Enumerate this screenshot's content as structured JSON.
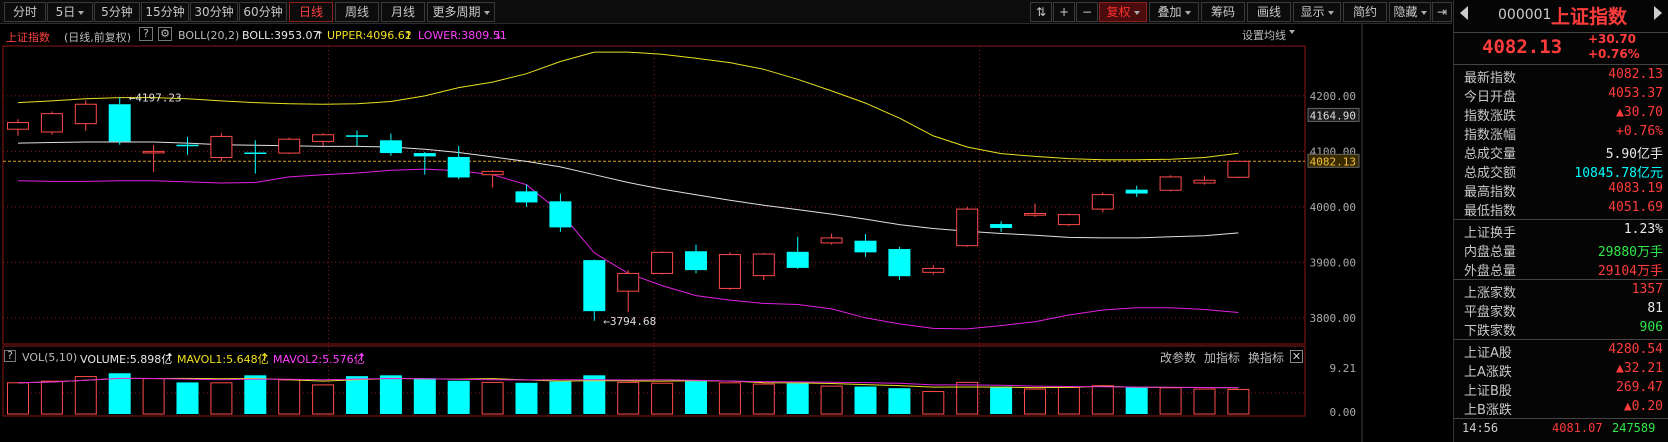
{
  "toolbar": {
    "left": [
      {
        "label": "分时",
        "x": 4,
        "w": 42
      },
      {
        "label": "5日",
        "x": 47,
        "w": 46,
        "caret": true
      },
      {
        "label": "5分钟",
        "x": 94,
        "w": 46
      },
      {
        "label": "15分钟",
        "x": 141,
        "w": 48
      },
      {
        "label": "30分钟",
        "x": 190,
        "w": 48
      },
      {
        "label": "60分钟",
        "x": 239,
        "w": 48
      },
      {
        "label": "日线",
        "x": 289,
        "w": 44,
        "active": true
      },
      {
        "label": "周线",
        "x": 335,
        "w": 44
      },
      {
        "label": "月线",
        "x": 381,
        "w": 44
      },
      {
        "label": "更多周期",
        "x": 427,
        "w": 68,
        "caret": true
      }
    ],
    "right": [
      {
        "label": "⇅",
        "x": 1030,
        "w": 22,
        "icon": "move-icon"
      },
      {
        "label": "+",
        "x": 1053,
        "w": 22,
        "icon": "zoom-in-icon"
      },
      {
        "label": "−",
        "x": 1076,
        "w": 22,
        "icon": "zoom-out-icon"
      },
      {
        "label": "复权",
        "x": 1099,
        "w": 48,
        "caret": true,
        "red": true
      },
      {
        "label": "叠加",
        "x": 1149,
        "w": 50,
        "caret": true
      },
      {
        "label": "筹码",
        "x": 1201,
        "w": 44
      },
      {
        "label": "画线",
        "x": 1247,
        "w": 44
      },
      {
        "label": "显示",
        "x": 1293,
        "w": 48,
        "caret": true
      },
      {
        "label": "简约",
        "x": 1343,
        "w": 44
      },
      {
        "label": "隐藏",
        "x": 1389,
        "w": 42,
        "caret": true
      },
      {
        "label": "⇥",
        "x": 1432,
        "w": 20,
        "icon": "collapse-icon"
      }
    ]
  },
  "info": {
    "name": "上证指数",
    "mode": "(日线,前复权)",
    "help": "?",
    "settings_icon": "gear-icon",
    "boll_label": "BOLL(20,2)",
    "boll_value": "BOLL:3953.07",
    "upper_value": "UPPER:4096.62",
    "lower_value": "LOWER:3809.51",
    "set_ma": "设置均线"
  },
  "vol_info": {
    "label": "VOL(5,10)",
    "volume": "VOLUME:5.898亿",
    "mavol1": "MAVOL1:5.648亿",
    "mavol2": "MAVOL2:5.576亿",
    "btn1": "改参数",
    "btn2": "加指标",
    "btn3": "换指标"
  },
  "chart_data": {
    "type": "candlestick",
    "ylim": [
      3760,
      4290
    ],
    "yticks": [
      3800,
      3900,
      4000,
      4100,
      4200
    ],
    "vol_ylim": [
      0,
      10.1
    ],
    "vol_ticks": [
      "9.21",
      "0.00"
    ],
    "price_labels": {
      "current": "4082.13",
      "upper": "4164.90"
    },
    "annotations": [
      {
        "text": "4197.23",
        "index": 3,
        "value": 4197.23
      },
      {
        "text": "3794.68",
        "index": 17,
        "value": 3794.68
      }
    ],
    "candles": [
      {
        "o": 4140,
        "c": 4152,
        "h": 4158,
        "l": 4128,
        "v": 7.5
      },
      {
        "o": 4135,
        "c": 4168,
        "h": 4172,
        "l": 4130,
        "v": 7.9
      },
      {
        "o": 4150,
        "c": 4185,
        "h": 4192,
        "l": 4137,
        "v": 9.0
      },
      {
        "o": 4185,
        "c": 4118,
        "h": 4197.23,
        "l": 4112,
        "v": 9.8
      },
      {
        "o": 4098,
        "c": 4100,
        "h": 4112,
        "l": 4063,
        "v": 8.5
      },
      {
        "o": 4112,
        "c": 4110,
        "h": 4126,
        "l": 4094,
        "v": 7.6
      },
      {
        "o": 4089,
        "c": 4127,
        "h": 4133,
        "l": 4082,
        "v": 7.5
      },
      {
        "o": 4098,
        "c": 4097,
        "h": 4120,
        "l": 4060,
        "v": 9.3
      },
      {
        "o": 4097,
        "c": 4122,
        "h": 4125,
        "l": 4095,
        "v": 8.2
      },
      {
        "o": 4118,
        "c": 4130,
        "h": 4133,
        "l": 4110,
        "v": 7.0
      },
      {
        "o": 4129,
        "c": 4127,
        "h": 4138,
        "l": 4110,
        "v": 9.1
      },
      {
        "o": 4120,
        "c": 4097,
        "h": 4132,
        "l": 4092,
        "v": 9.3
      },
      {
        "o": 4097,
        "c": 4091,
        "h": 4099,
        "l": 4058,
        "v": 8.6
      },
      {
        "o": 4090,
        "c": 4053,
        "h": 4110,
        "l": 4050,
        "v": 8.0
      },
      {
        "o": 4058,
        "c": 4064,
        "h": 4066,
        "l": 4035,
        "v": 7.6
      },
      {
        "o": 4028,
        "c": 4008,
        "h": 4040,
        "l": 4000,
        "v": 7.5
      },
      {
        "o": 4010,
        "c": 3963,
        "h": 4024,
        "l": 3955,
        "v": 7.8
      },
      {
        "o": 3904,
        "c": 3812,
        "h": 3905,
        "l": 3794.68,
        "v": 9.3
      },
      {
        "o": 3848,
        "c": 3880,
        "h": 3886,
        "l": 3810,
        "v": 7.6
      },
      {
        "o": 3880,
        "c": 3918,
        "h": 3920,
        "l": 3878,
        "v": 7.4
      },
      {
        "o": 3920,
        "c": 3886,
        "h": 3932,
        "l": 3880,
        "v": 7.9
      },
      {
        "o": 3853,
        "c": 3914,
        "h": 3918,
        "l": 3850,
        "v": 7.5
      },
      {
        "o": 3876,
        "c": 3915,
        "h": 3917,
        "l": 3868,
        "v": 7.2
      },
      {
        "o": 3919,
        "c": 3890,
        "h": 3946,
        "l": 3888,
        "v": 7.4
      },
      {
        "o": 3935,
        "c": 3944,
        "h": 3952,
        "l": 3932,
        "v": 6.7
      },
      {
        "o": 3939,
        "c": 3918,
        "h": 3951,
        "l": 3910,
        "v": 6.6
      },
      {
        "o": 3924,
        "c": 3875,
        "h": 3928,
        "l": 3868,
        "v": 6.2
      },
      {
        "o": 3882,
        "c": 3889,
        "h": 3895,
        "l": 3878,
        "v": 5.4
      },
      {
        "o": 3930,
        "c": 3996,
        "h": 4000,
        "l": 3928,
        "v": 7.6
      },
      {
        "o": 3969,
        "c": 3962,
        "h": 3974,
        "l": 3955,
        "v": 6.6
      },
      {
        "o": 3985,
        "c": 3988,
        "h": 4006,
        "l": 3982,
        "v": 6.0
      },
      {
        "o": 3968,
        "c": 3986,
        "h": 3988,
        "l": 3965,
        "v": 6.4
      },
      {
        "o": 3996,
        "c": 4022,
        "h": 4026,
        "l": 3990,
        "v": 6.8
      },
      {
        "o": 4031,
        "c": 4024,
        "h": 4038,
        "l": 4018,
        "v": 6.4
      },
      {
        "o": 4030,
        "c": 4054,
        "h": 4057,
        "l": 4028,
        "v": 6.3
      },
      {
        "o": 4043,
        "c": 4048,
        "h": 4056,
        "l": 4040,
        "v": 6.0
      },
      {
        "o": 4053.37,
        "c": 4082.13,
        "h": 4083.19,
        "l": 4051.69,
        "v": 5.9
      }
    ],
    "mid": [
      4115,
      4116,
      4117,
      4117,
      4117,
      4115,
      4112,
      4111,
      4110,
      4109,
      4109,
      4108,
      4104,
      4098,
      4090,
      4082,
      4072,
      4058,
      4044,
      4032,
      4022,
      4012,
      4003,
      3995,
      3987,
      3978,
      3968,
      3961,
      3956,
      3952,
      3949,
      3945,
      3944,
      3944,
      3946,
      3948,
      3953.07
    ],
    "upper": [
      4188,
      4191,
      4195,
      4197,
      4197,
      4195,
      4191,
      4188,
      4186,
      4185,
      4186,
      4190,
      4200,
      4215,
      4225,
      4240,
      4262,
      4279,
      4279,
      4275,
      4268,
      4260,
      4248,
      4230,
      4209,
      4187,
      4160,
      4128,
      4108,
      4096,
      4091,
      4087,
      4085,
      4085,
      4086,
      4089,
      4096.62
    ],
    "lower": [
      4047,
      4046,
      4046,
      4047,
      4047,
      4045,
      4043,
      4044,
      4054,
      4058,
      4061,
      4066,
      4068,
      4065,
      4058,
      4040,
      3990,
      3917,
      3880,
      3858,
      3840,
      3832,
      3826,
      3824,
      3816,
      3800,
      3789,
      3781,
      3780,
      3786,
      3793,
      3805,
      3814,
      3818,
      3818,
      3815,
      3809.51
    ]
  },
  "quote": {
    "code": "000001",
    "name": "上证指数",
    "price": "4082.13",
    "change": "+30.70",
    "change_pct": "+0.76%",
    "rows1": [
      {
        "label": "最新指数",
        "value": "4082.13",
        "color": "red"
      },
      {
        "label": "今日开盘",
        "value": "4053.37",
        "color": "red"
      },
      {
        "label": "指数涨跌",
        "value": "▲30.70",
        "color": "red"
      },
      {
        "label": "指数涨幅",
        "value": "+0.76%",
        "color": "red"
      },
      {
        "label": "总成交量",
        "value": "5.90亿手",
        "color": "white"
      },
      {
        "label": "总成交额",
        "value": "10845.78亿元",
        "color": "cyan"
      },
      {
        "label": "最高指数",
        "value": "4083.19",
        "color": "red"
      },
      {
        "label": "最低指数",
        "value": "4051.69",
        "color": "red"
      }
    ],
    "rows2": [
      {
        "label": "上证换手",
        "value": "1.23%",
        "color": "white"
      },
      {
        "label": "内盘总量",
        "value": "29880万手",
        "color": "green"
      },
      {
        "label": "外盘总量",
        "value": "29104万手",
        "color": "red"
      }
    ],
    "rows3": [
      {
        "label": "上涨家数",
        "value": "1357",
        "color": "red"
      },
      {
        "label": "平盘家数",
        "value": "81",
        "color": "white"
      },
      {
        "label": "下跌家数",
        "value": "906",
        "color": "green"
      }
    ],
    "rows4": [
      {
        "label": "上证A股",
        "value": "4280.54",
        "color": "red"
      },
      {
        "label": "上A涨跌",
        "value": "▲32.21",
        "color": "red"
      },
      {
        "label": "上证B股",
        "value": "269.47",
        "color": "red"
      },
      {
        "label": "上B涨跌",
        "value": "▲0.20",
        "color": "red"
      }
    ],
    "tick_row": {
      "time": "14:56",
      "price": "4081.07",
      "vol": "247589"
    }
  },
  "colors": {
    "up": "#ff4a4a",
    "down": "#00ffff",
    "mid": "#e0e0e0",
    "upper": "#e8e020",
    "lower": "#e020e0",
    "grid": "#8a1818"
  }
}
